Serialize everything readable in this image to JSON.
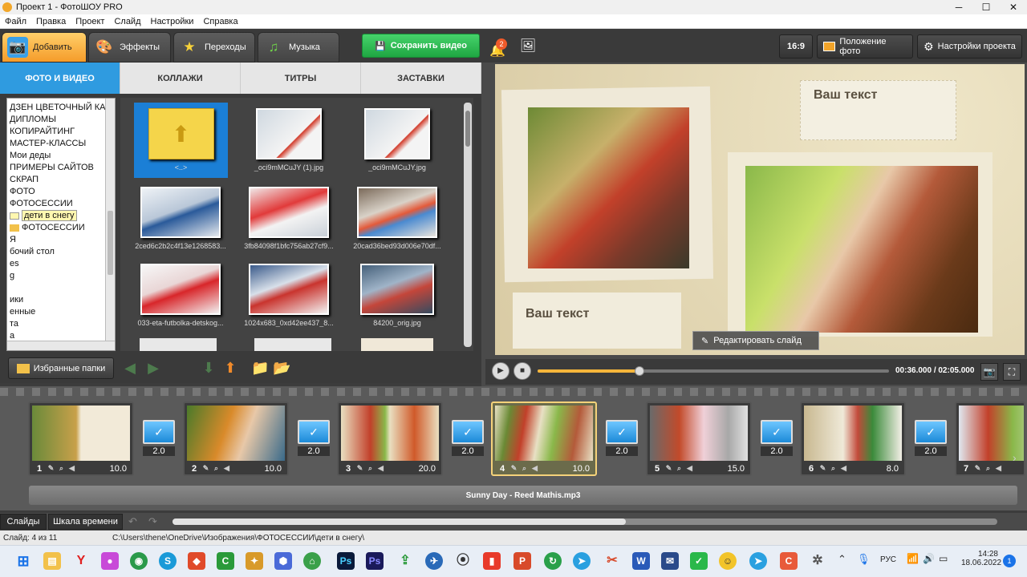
{
  "window": {
    "title": "Проект 1 - ФотоШОУ PRO"
  },
  "menu": [
    "Файл",
    "Правка",
    "Проект",
    "Слайд",
    "Настройки",
    "Справка"
  ],
  "main_tabs": [
    {
      "label": "Добавить",
      "icon": "camera-icon"
    },
    {
      "label": "Эффекты",
      "icon": "palette-icon"
    },
    {
      "label": "Переходы",
      "icon": "star-icon"
    },
    {
      "label": "Музыка",
      "icon": "music-note-icon"
    }
  ],
  "toolbar": {
    "save_label": "Сохранить видео",
    "notifications_count": "2",
    "aspect_ratio": "16:9",
    "photo_position_label": "Положение фото",
    "project_settings_label": "Настройки проекта"
  },
  "sub_tabs": [
    "ФОТО И ВИДЕО",
    "КОЛЛАЖИ",
    "ТИТРЫ",
    "ЗАСТАВКИ"
  ],
  "folders": [
    "ДЗЕН ЦВЕТОЧНЫЙ КАН",
    "ДИПЛОМЫ",
    "КОПИРАЙТИНГ",
    "МАСТЕР-КЛАССЫ",
    "Мои деды",
    "ПРИМЕРЫ САЙТОВ",
    "СКРАП",
    "ФОТО",
    "ФОТОСЕССИИ",
    "дети в снегу",
    "ФОТОСЕССИИ",
    "Я",
    "бочий стол",
    "es",
    "g",
    "",
    "ики",
    "енные",
    "та",
    "а"
  ],
  "files": [
    {
      "name": "<..>",
      "type": "up"
    },
    {
      "name": "_oci9mMCuJY (1).jpg"
    },
    {
      "name": "_oci9mMCuJY.jpg"
    },
    {
      "name": "2ced6c2b2c4f13e1268583..."
    },
    {
      "name": "3fb84098f1bfc756ab27cf9..."
    },
    {
      "name": "20cad36bed93d006e70df..."
    },
    {
      "name": "033-eta-futbolka-detskog..."
    },
    {
      "name": "1024x683_0xd42ee437_8..."
    },
    {
      "name": "84200_orig.jpg"
    }
  ],
  "favorites_label": "Избранные папки",
  "preview": {
    "text1": "Ваш текст",
    "text2": "Ваш текст",
    "edit_slide_label": "Редактировать слайд"
  },
  "player": {
    "time": "00:36.000 / 02:05.000",
    "progress": 0.29
  },
  "slides": [
    {
      "num": "1",
      "dur": "10.0"
    },
    {
      "num": "2",
      "dur": "10.0"
    },
    {
      "num": "3",
      "dur": "20.0"
    },
    {
      "num": "4",
      "dur": "10.0"
    },
    {
      "num": "5",
      "dur": "15.0"
    },
    {
      "num": "6",
      "dur": "8.0"
    },
    {
      "num": "7",
      "dur": ""
    }
  ],
  "transitions": [
    "2.0",
    "2.0",
    "2.0",
    "2.0",
    "2.0",
    "2.0"
  ],
  "music_track": "Sunny Day - Reed Mathis.mp3",
  "bottom_tabs": [
    "Слайды",
    "Шкала времени"
  ],
  "status": {
    "slide": "Слайд: 4 из 11",
    "path": "C:\\Users\\thene\\OneDrive\\Изображения\\ФОТОСЕССИИ\\дети в снегу\\"
  },
  "taskbar": {
    "lang": "РУС",
    "time": "14:28",
    "date": "18.06.2022",
    "notif": "1"
  },
  "colors": {
    "accent": "#2f9be0",
    "save_green": "#1fa642",
    "active_tab": "#f59c2a",
    "current_slide": "#f5d27a"
  }
}
